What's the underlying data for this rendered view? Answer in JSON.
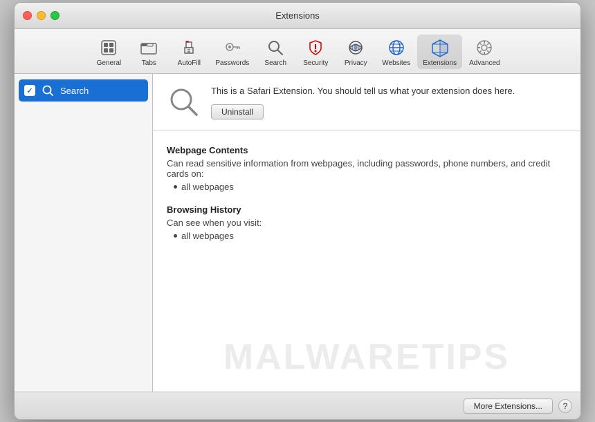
{
  "window": {
    "title": "Extensions"
  },
  "toolbar": {
    "items": [
      {
        "id": "general",
        "label": "General",
        "icon": "general"
      },
      {
        "id": "tabs",
        "label": "Tabs",
        "icon": "tabs"
      },
      {
        "id": "autofill",
        "label": "AutoFill",
        "icon": "autofill"
      },
      {
        "id": "passwords",
        "label": "Passwords",
        "icon": "passwords"
      },
      {
        "id": "search",
        "label": "Search",
        "icon": "search"
      },
      {
        "id": "security",
        "label": "Security",
        "icon": "security"
      },
      {
        "id": "privacy",
        "label": "Privacy",
        "icon": "privacy"
      },
      {
        "id": "websites",
        "label": "Websites",
        "icon": "websites"
      },
      {
        "id": "extensions",
        "label": "Extensions",
        "icon": "extensions",
        "active": true
      },
      {
        "id": "advanced",
        "label": "Advanced",
        "icon": "advanced"
      }
    ]
  },
  "sidebar": {
    "items": [
      {
        "id": "search-ext",
        "label": "Search",
        "enabled": true,
        "selected": true
      }
    ]
  },
  "extension": {
    "description": "This is a Safari Extension. You should tell us what your extension does here.",
    "uninstall_label": "Uninstall",
    "permissions": {
      "webpage_contents_title": "Webpage Contents",
      "webpage_contents_desc": "Can read sensitive information from webpages, including passwords, phone numbers, and credit cards on:",
      "webpage_contents_list": [
        "all webpages"
      ],
      "browsing_history_title": "Browsing History",
      "browsing_history_desc": "Can see when you visit:",
      "browsing_history_list": [
        "all webpages"
      ]
    }
  },
  "footer": {
    "more_extensions_label": "More Extensions...",
    "help_label": "?"
  },
  "watermark": {
    "text": "MALWARETIPS"
  }
}
